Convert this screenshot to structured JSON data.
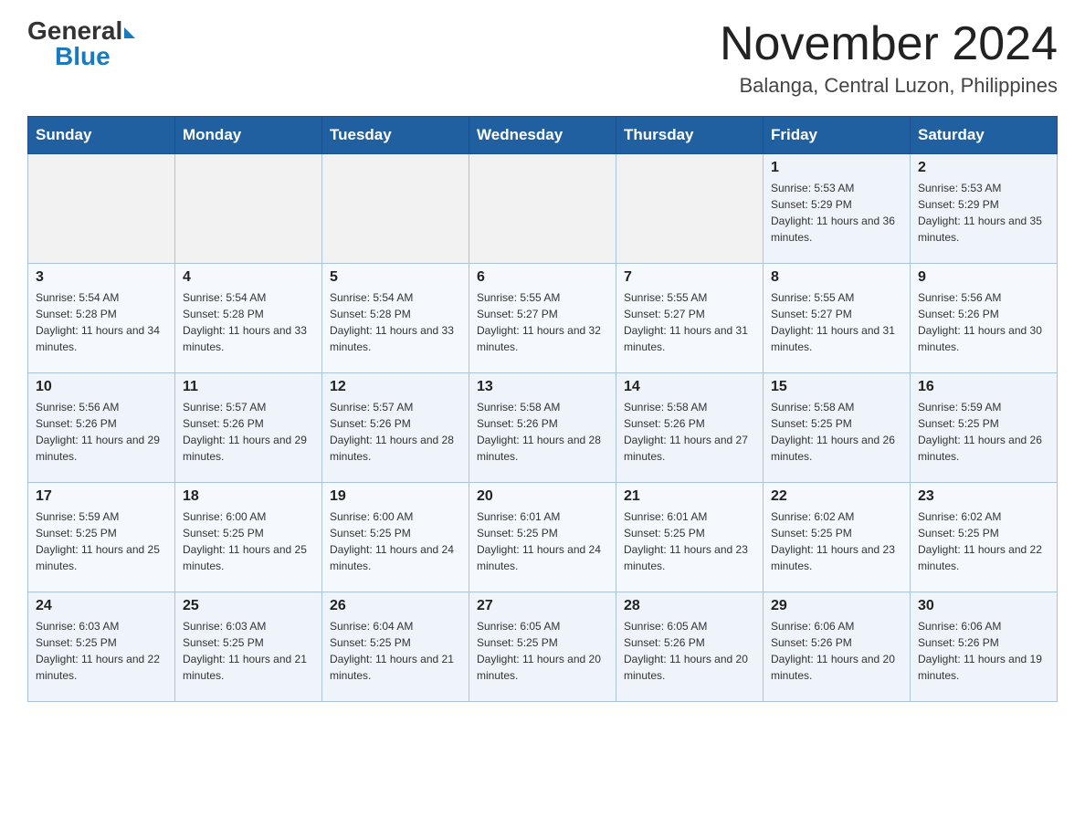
{
  "header": {
    "logo_general": "General",
    "logo_blue": "Blue",
    "title": "November 2024",
    "location": "Balanga, Central Luzon, Philippines"
  },
  "days_of_week": [
    "Sunday",
    "Monday",
    "Tuesday",
    "Wednesday",
    "Thursday",
    "Friday",
    "Saturday"
  ],
  "weeks": [
    [
      {
        "day": "",
        "info": ""
      },
      {
        "day": "",
        "info": ""
      },
      {
        "day": "",
        "info": ""
      },
      {
        "day": "",
        "info": ""
      },
      {
        "day": "",
        "info": ""
      },
      {
        "day": "1",
        "info": "Sunrise: 5:53 AM\nSunset: 5:29 PM\nDaylight: 11 hours and 36 minutes."
      },
      {
        "day": "2",
        "info": "Sunrise: 5:53 AM\nSunset: 5:29 PM\nDaylight: 11 hours and 35 minutes."
      }
    ],
    [
      {
        "day": "3",
        "info": "Sunrise: 5:54 AM\nSunset: 5:28 PM\nDaylight: 11 hours and 34 minutes."
      },
      {
        "day": "4",
        "info": "Sunrise: 5:54 AM\nSunset: 5:28 PM\nDaylight: 11 hours and 33 minutes."
      },
      {
        "day": "5",
        "info": "Sunrise: 5:54 AM\nSunset: 5:28 PM\nDaylight: 11 hours and 33 minutes."
      },
      {
        "day": "6",
        "info": "Sunrise: 5:55 AM\nSunset: 5:27 PM\nDaylight: 11 hours and 32 minutes."
      },
      {
        "day": "7",
        "info": "Sunrise: 5:55 AM\nSunset: 5:27 PM\nDaylight: 11 hours and 31 minutes."
      },
      {
        "day": "8",
        "info": "Sunrise: 5:55 AM\nSunset: 5:27 PM\nDaylight: 11 hours and 31 minutes."
      },
      {
        "day": "9",
        "info": "Sunrise: 5:56 AM\nSunset: 5:26 PM\nDaylight: 11 hours and 30 minutes."
      }
    ],
    [
      {
        "day": "10",
        "info": "Sunrise: 5:56 AM\nSunset: 5:26 PM\nDaylight: 11 hours and 29 minutes."
      },
      {
        "day": "11",
        "info": "Sunrise: 5:57 AM\nSunset: 5:26 PM\nDaylight: 11 hours and 29 minutes."
      },
      {
        "day": "12",
        "info": "Sunrise: 5:57 AM\nSunset: 5:26 PM\nDaylight: 11 hours and 28 minutes."
      },
      {
        "day": "13",
        "info": "Sunrise: 5:58 AM\nSunset: 5:26 PM\nDaylight: 11 hours and 28 minutes."
      },
      {
        "day": "14",
        "info": "Sunrise: 5:58 AM\nSunset: 5:26 PM\nDaylight: 11 hours and 27 minutes."
      },
      {
        "day": "15",
        "info": "Sunrise: 5:58 AM\nSunset: 5:25 PM\nDaylight: 11 hours and 26 minutes."
      },
      {
        "day": "16",
        "info": "Sunrise: 5:59 AM\nSunset: 5:25 PM\nDaylight: 11 hours and 26 minutes."
      }
    ],
    [
      {
        "day": "17",
        "info": "Sunrise: 5:59 AM\nSunset: 5:25 PM\nDaylight: 11 hours and 25 minutes."
      },
      {
        "day": "18",
        "info": "Sunrise: 6:00 AM\nSunset: 5:25 PM\nDaylight: 11 hours and 25 minutes."
      },
      {
        "day": "19",
        "info": "Sunrise: 6:00 AM\nSunset: 5:25 PM\nDaylight: 11 hours and 24 minutes."
      },
      {
        "day": "20",
        "info": "Sunrise: 6:01 AM\nSunset: 5:25 PM\nDaylight: 11 hours and 24 minutes."
      },
      {
        "day": "21",
        "info": "Sunrise: 6:01 AM\nSunset: 5:25 PM\nDaylight: 11 hours and 23 minutes."
      },
      {
        "day": "22",
        "info": "Sunrise: 6:02 AM\nSunset: 5:25 PM\nDaylight: 11 hours and 23 minutes."
      },
      {
        "day": "23",
        "info": "Sunrise: 6:02 AM\nSunset: 5:25 PM\nDaylight: 11 hours and 22 minutes."
      }
    ],
    [
      {
        "day": "24",
        "info": "Sunrise: 6:03 AM\nSunset: 5:25 PM\nDaylight: 11 hours and 22 minutes."
      },
      {
        "day": "25",
        "info": "Sunrise: 6:03 AM\nSunset: 5:25 PM\nDaylight: 11 hours and 21 minutes."
      },
      {
        "day": "26",
        "info": "Sunrise: 6:04 AM\nSunset: 5:25 PM\nDaylight: 11 hours and 21 minutes."
      },
      {
        "day": "27",
        "info": "Sunrise: 6:05 AM\nSunset: 5:25 PM\nDaylight: 11 hours and 20 minutes."
      },
      {
        "day": "28",
        "info": "Sunrise: 6:05 AM\nSunset: 5:26 PM\nDaylight: 11 hours and 20 minutes."
      },
      {
        "day": "29",
        "info": "Sunrise: 6:06 AM\nSunset: 5:26 PM\nDaylight: 11 hours and 20 minutes."
      },
      {
        "day": "30",
        "info": "Sunrise: 6:06 AM\nSunset: 5:26 PM\nDaylight: 11 hours and 19 minutes."
      }
    ]
  ]
}
